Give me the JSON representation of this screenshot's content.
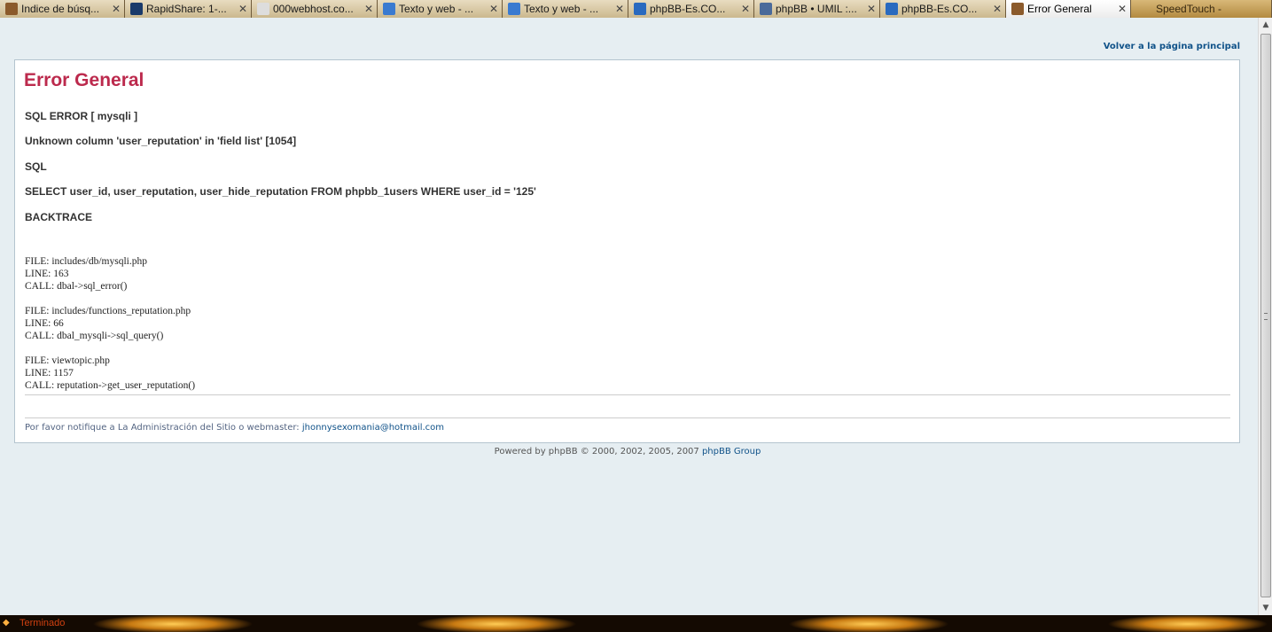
{
  "browser": {
    "tabs": [
      {
        "label": "Indice de búsq...",
        "close": "✕",
        "favicon_color": "#8b5a2b",
        "state": "normal"
      },
      {
        "label": "RapidShare: 1-...",
        "close": "✕",
        "favicon_color": "#1a3a6a",
        "state": "normal"
      },
      {
        "label": "000webhost.co...",
        "close": "✕",
        "favicon_color": "#dddddd",
        "state": "normal"
      },
      {
        "label": "Texto y web - ...",
        "close": "✕",
        "favicon_color": "#3a7ad0",
        "state": "normal"
      },
      {
        "label": "Texto y web - ...",
        "close": "✕",
        "favicon_color": "#3a7ad0",
        "state": "normal"
      },
      {
        "label": "phpBB-Es.CO...",
        "close": "✕",
        "favicon_color": "#2a6abf",
        "state": "normal"
      },
      {
        "label": "phpBB • UMIL :...",
        "close": "✕",
        "favicon_color": "#4a6a9a",
        "state": "normal"
      },
      {
        "label": "phpBB-Es.CO...",
        "close": "✕",
        "favicon_color": "#2a6abf",
        "state": "normal"
      },
      {
        "label": "Error General",
        "close": "✕",
        "favicon_color": "#8b5a2b",
        "state": "active"
      },
      {
        "label": "SpeedTouch -",
        "close": "",
        "favicon_color": "#b38a40",
        "state": "faded"
      }
    ],
    "status_text": "Terminado"
  },
  "page": {
    "home_link": "Volver a la página principal",
    "title": "Error General",
    "sql_error": "SQL ERROR [ mysqli ]",
    "error_message": "Unknown column 'user_reputation' in 'field list' [1054]",
    "sql_label": "SQL",
    "sql_query": "SELECT user_id, user_reputation, user_hide_reputation FROM phpbb_1users WHERE user_id = '125'",
    "backtrace_label": "BACKTRACE",
    "backtrace": [
      {
        "file": "FILE: includes/db/mysqli.php",
        "line": "LINE: 163",
        "call": "CALL: dbal->sql_error()"
      },
      {
        "file": "FILE: includes/functions_reputation.php",
        "line": "LINE: 66",
        "call": "CALL: dbal_mysqli->sql_query()"
      },
      {
        "file": "FILE: viewtopic.php",
        "line": "LINE: 1157",
        "call": "CALL: reputation->get_user_reputation()"
      }
    ],
    "notice_text": "Por favor notifique a La Administración del Sitio o webmaster: ",
    "notice_email": "jhonnysexomania@hotmail.com",
    "powered_text": "Powered by phpBB © 2000, 2002, 2005, 2007 ",
    "powered_link": "phpBB Group"
  },
  "colors": {
    "title": "#bc2a4d",
    "link": "#105289",
    "background": "#e6eef2"
  }
}
